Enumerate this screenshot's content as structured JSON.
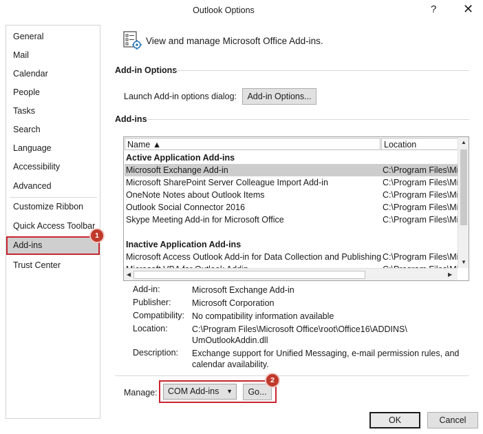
{
  "window": {
    "title": "Outlook Options",
    "help_glyph": "?",
    "close_glyph": "✕"
  },
  "sidebar": {
    "items": [
      {
        "label": "General"
      },
      {
        "label": "Mail"
      },
      {
        "label": "Calendar"
      },
      {
        "label": "People"
      },
      {
        "label": "Tasks"
      },
      {
        "label": "Search"
      },
      {
        "label": "Language"
      },
      {
        "label": "Accessibility"
      },
      {
        "label": "Advanced"
      },
      {
        "label": "Customize Ribbon"
      },
      {
        "label": "Quick Access Toolbar"
      },
      {
        "label": "Add-ins"
      },
      {
        "label": "Trust Center"
      }
    ],
    "selected": "Add-ins"
  },
  "badges": {
    "one": "1",
    "two": "2"
  },
  "header": {
    "text": "View and manage Microsoft Office Add-ins."
  },
  "addin_options": {
    "title": "Add-in Options",
    "launch_label": "Launch Add-in options dialog:",
    "button_label": "Add-in Options..."
  },
  "addins": {
    "title": "Add-ins",
    "columns": {
      "name": "Name ▲",
      "location": "Location"
    },
    "groups": {
      "active": "Active Application Add-ins",
      "inactive": "Inactive Application Add-ins"
    },
    "active_rows": [
      {
        "name": "Microsoft Exchange Add-in",
        "location": "C:\\Program Files\\Mi"
      },
      {
        "name": "Microsoft SharePoint Server Colleague Import Add-in",
        "location": "C:\\Program Files\\Mi"
      },
      {
        "name": "OneNote Notes about Outlook Items",
        "location": "C:\\Program Files\\Mi"
      },
      {
        "name": "Outlook Social Connector 2016",
        "location": "C:\\Program Files\\Mi"
      },
      {
        "name": "Skype Meeting Add-in for Microsoft Office",
        "location": "C:\\Program Files\\Mi"
      }
    ],
    "inactive_rows": [
      {
        "name": "Microsoft Access Outlook Add-in for Data Collection and Publishing",
        "location": "C:\\Program Files\\Mi"
      },
      {
        "name": "Microsoft VBA for Outlook Addin",
        "location": "C:\\Program Files\\Mi"
      }
    ]
  },
  "details": {
    "addin_label": "Add-in:",
    "addin": "Microsoft Exchange Add-in",
    "publisher_label": "Publisher:",
    "publisher": "Microsoft Corporation",
    "compat_label": "Compatibility:",
    "compat": "No compatibility information available",
    "location_label": "Location:",
    "location_line1": "C:\\Program Files\\Microsoft Office\\root\\Office16\\ADDINS\\",
    "location_line2": "UmOutlookAddin.dll",
    "description_label": "Description:",
    "description_line1": "Exchange support for Unified Messaging, e-mail permission rules, and",
    "description_line2": "calendar availability."
  },
  "manage": {
    "label": "Manage:",
    "selected": "COM Add-ins",
    "go_label": "Go..."
  },
  "footer": {
    "ok_label": "OK",
    "cancel_label": "Cancel"
  },
  "colors": {
    "accent_red": "#c8242f",
    "selection": "#cdcdcd"
  }
}
